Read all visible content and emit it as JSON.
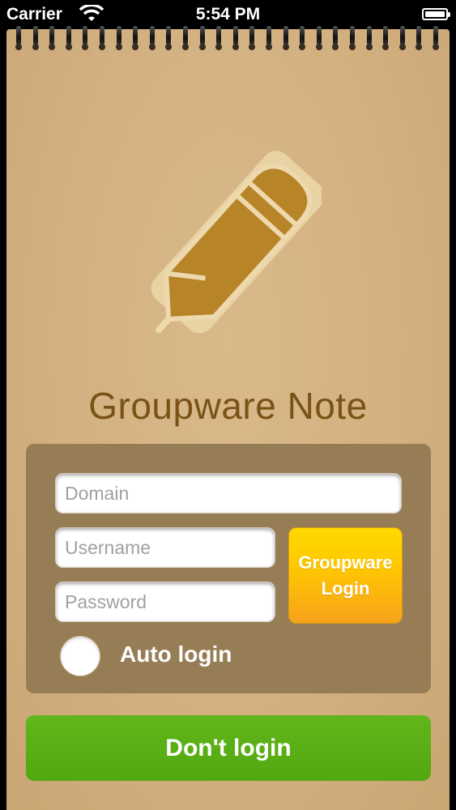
{
  "status_bar": {
    "carrier": "Carrier",
    "time": "5:54 PM"
  },
  "app": {
    "title": "Groupware Note"
  },
  "login_form": {
    "domain_placeholder": "Domain",
    "username_placeholder": "Username",
    "password_placeholder": "Password",
    "login_button_line1": "Groupware",
    "login_button_line2": "Login",
    "auto_login_label": "Auto login",
    "auto_login_checked": false
  },
  "dont_login_button": "Don't login",
  "colors": {
    "title": "#7b5216",
    "panel": "#977d56",
    "login_button": "#ffc800",
    "dont_login": "#5aaf14",
    "pencil": "#b88428"
  },
  "icons": [
    "wifi-icon",
    "battery-icon",
    "pencil-icon"
  ]
}
